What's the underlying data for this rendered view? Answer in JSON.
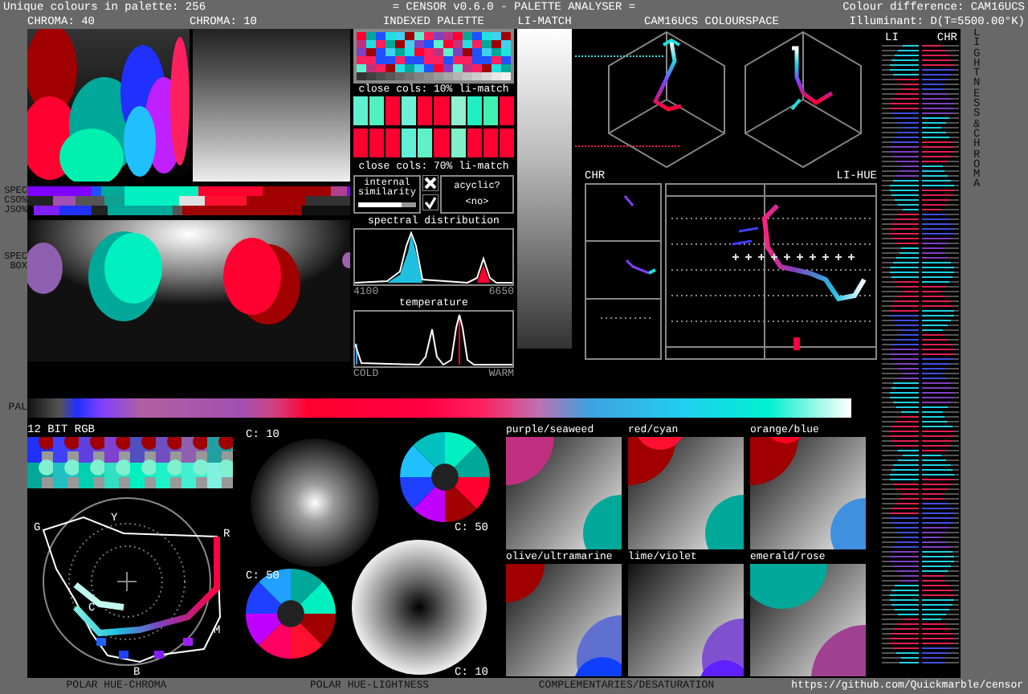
{
  "header": {
    "palette_count": "Unique colours in palette: 256",
    "title": "= CENSOR v0.6.0 - PALETTE ANALYSER =",
    "colour_difference": "Colour difference: CAM16UCS",
    "illuminant": "Illuminant: D(T=5500.00°K)"
  },
  "panel_labels": {
    "chroma_40": "CHROMA: 40",
    "chroma_10": "CHROMA: 10",
    "indexed_palette": "INDEXED PALETTE",
    "li_match": "LI-MATCH",
    "colourspace": "CAM16UCS COLOURSPACE"
  },
  "spectrum_rows": [
    {
      "label": "SPEC"
    },
    {
      "label": "CSO%"
    },
    {
      "label": "JSO%"
    }
  ],
  "spec_box": {
    "label": "SPEC BOX"
  },
  "close_cols": [
    {
      "label": "close cols: 10% li-match",
      "swatches": [
        {
          "color": "#60f0d0"
        },
        {
          "color": "#50f0c0"
        },
        {
          "color": "#ff0030"
        },
        {
          "color": "#70f0d8"
        },
        {
          "color": "#ff0030"
        },
        {
          "color": "#ff0030"
        },
        {
          "color": "#90f0d0"
        },
        {
          "color": "#20f0c0"
        },
        {
          "color": "#40f0b0"
        },
        {
          "color": "#ff0030"
        }
      ]
    },
    {
      "label": "close cols: 70% li-match",
      "swatches": [
        {
          "color": "#ff0030"
        },
        {
          "color": "#ff0030"
        },
        {
          "color": "#ff0030"
        },
        {
          "color": "#60f0d8"
        },
        {
          "color": "#60f0c8"
        },
        {
          "color": "#ff0030"
        },
        {
          "color": "#80f0c8"
        },
        {
          "color": "#ff0030"
        },
        {
          "color": "#ff0030"
        },
        {
          "color": "#ff0030"
        }
      ]
    }
  ],
  "similarity": {
    "label": "internal similarity",
    "level": 0.75
  },
  "acyclic": {
    "label": "acyclic?",
    "value": "<no>"
  },
  "spectral": {
    "title": "spectral distribution",
    "min": "4100",
    "max": "6650"
  },
  "temperature": {
    "title": "temperature",
    "min": "COLD",
    "max": "WARM"
  },
  "plots": {
    "chr": "CHR",
    "li_hue": "LI-HUE"
  },
  "pal_label": "PAL",
  "rgb12": {
    "title": "12 BIT RGB"
  },
  "polar_chroma": {
    "hue_labels": [
      "G",
      "Y",
      "R",
      "C",
      "M",
      "B"
    ],
    "caption": "POLAR HUE-CHROMA"
  },
  "polar_lightness": {
    "caption": "POLAR HUE-LIGHTNESS",
    "discs": [
      {
        "label": "C: 10",
        "kind": "desaturated"
      },
      {
        "label": "C: 50",
        "kind": "saturated"
      },
      {
        "label": "C: 50",
        "kind": "saturated"
      },
      {
        "label": "C: 10",
        "kind": "desaturated"
      }
    ]
  },
  "complementaries": {
    "caption": "COMPLEMENTARIES/DESATURATION",
    "pairs": [
      {
        "label": "purple/seaweed"
      },
      {
        "label": "red/cyan"
      },
      {
        "label": "orange/blue"
      },
      {
        "label": "olive/ultramarine"
      },
      {
        "label": "lime/violet"
      },
      {
        "label": "emerald/rose"
      }
    ]
  },
  "stripes": {
    "li": "LI",
    "chr": "CHR",
    "side_title": "LIGHTNESS & CHROMA"
  },
  "footer_url": "https://github.com/Quickmarble/censor"
}
